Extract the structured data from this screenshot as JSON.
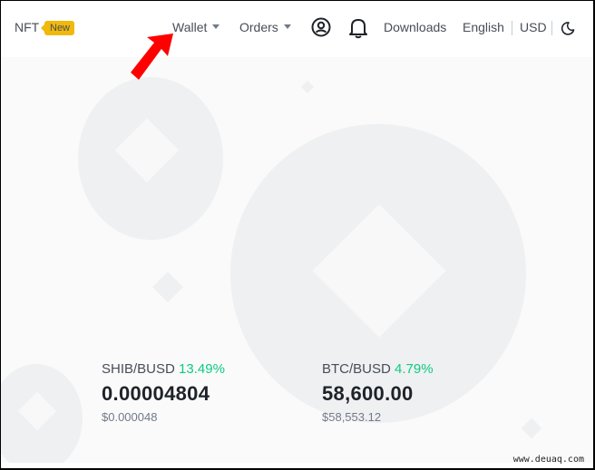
{
  "header": {
    "nft_label": "NFT",
    "new_badge": "New",
    "wallet_label": "Wallet",
    "orders_label": "Orders",
    "downloads_label": "Downloads",
    "language_label": "English",
    "currency_label": "USD",
    "icons": [
      "profile-icon",
      "bell-icon",
      "moon-icon"
    ]
  },
  "annotation": {
    "arrow_color": "#ff0000",
    "target": "Wallet"
  },
  "tickers": [
    {
      "pair": "SHIB/BUSD",
      "change": "13.49%",
      "price": "0.00004804",
      "usd_price": "$0.000048"
    },
    {
      "pair": "BTC/BUSD",
      "change": "4.79%",
      "price": "58,600.00",
      "usd_price": "$58,553.12"
    }
  ],
  "colors": {
    "brand_yellow": "#f0b90b",
    "positive_green": "#0ecb81",
    "text_primary": "#1e2329",
    "text_secondary": "#707a8a"
  },
  "watermark": "www.deuaq.com"
}
